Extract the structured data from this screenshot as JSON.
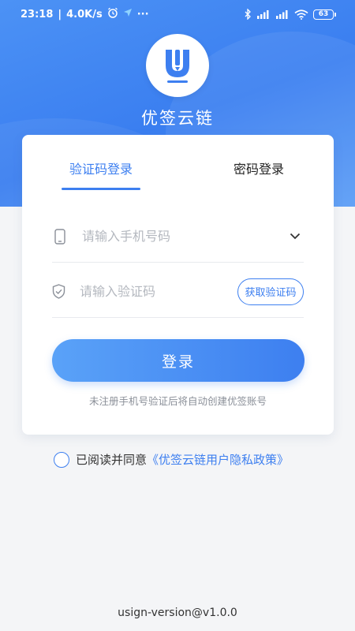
{
  "status_bar": {
    "time": "23:18",
    "speed": "4.0K/s",
    "dots": "···",
    "battery": "63"
  },
  "app": {
    "name": "优签云链",
    "logo_letter": "U"
  },
  "tabs": {
    "sms_login": "验证码登录",
    "password_login": "密码登录",
    "active": "sms_login"
  },
  "form": {
    "phone_placeholder": "请输入手机号码",
    "code_placeholder": "请输入验证码",
    "get_code_label": "获取验证码",
    "login_label": "登录",
    "hint": "未注册手机号验证后将自动创建优签账号"
  },
  "agreement": {
    "prefix": "已阅读并同意",
    "policy": "《优签云链用户隐私政策》",
    "checked": false
  },
  "footer": {
    "version": "usign-version@v1.0.0"
  },
  "colors": {
    "accent": "#3d7ff0",
    "header": "#4c92f5"
  }
}
